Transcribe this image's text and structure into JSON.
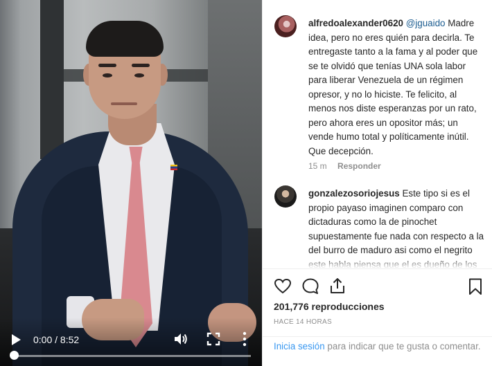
{
  "video": {
    "time_display": "0:00 / 8:52",
    "progress_fraction": 0.0,
    "icons": [
      "play-icon",
      "volume-icon",
      "fullscreen-icon",
      "more-options-icon"
    ]
  },
  "comments": [
    {
      "username": "alfredoalexander0620",
      "mention": "@jguaido",
      "text": "Madre idea, pero no eres quién para decirla. Te entregaste tanto a la fama y al poder que se te olvidó que tenías UNA sola labor para liberar Venezuela de un régimen opresor, y no lo hiciste. Te felicito, al menos nos diste esperanzas por un rato, pero ahora eres un opositor más; un vende humo total y políticamente inútil. Que decepción.",
      "age": "15 m",
      "reply_label": "Responder"
    },
    {
      "username": "gonzalezosoriojesus",
      "text": "Este tipo si es el propio payaso imaginen comparo con dictaduras como la de pinochet supuestamente fue nada con respecto a la del burro de maduro asi como el negrito este habla piensa que el es dueño de los conocimientos y los"
    }
  ],
  "actions": {
    "icons": [
      "heart-icon",
      "comment-icon",
      "share-icon",
      "bookmark-icon"
    ],
    "views": "201,776 reproducciones",
    "posted_ago": "HACE 14 HORAS"
  },
  "login": {
    "link": "Inicia sesión",
    "text": " para indicar que te gusta o comentar."
  },
  "colors": {
    "link": "#3897f0",
    "mention": "#1a5b8f",
    "muted": "#8e8e8e",
    "text": "#262626"
  }
}
